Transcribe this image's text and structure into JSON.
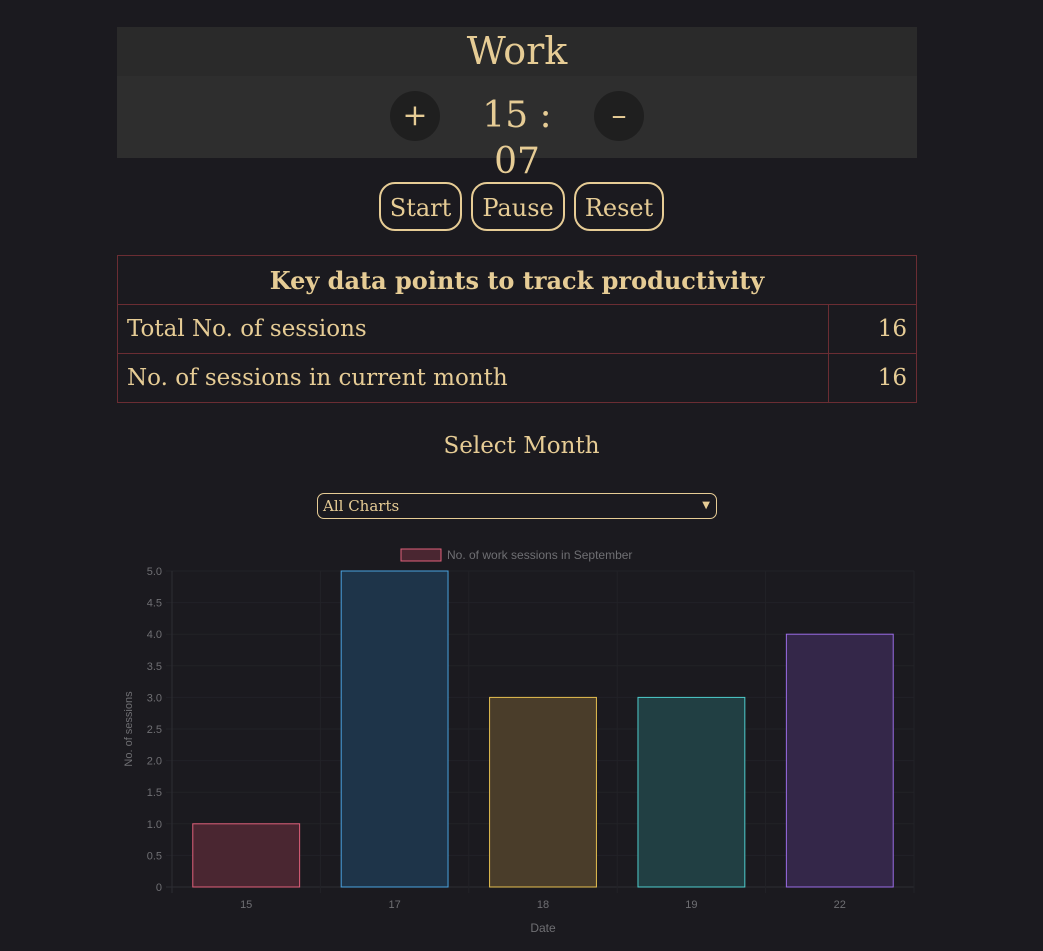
{
  "timer": {
    "mode": "Work",
    "increase_label": "+",
    "time": "15 : 07",
    "decrease_label": "–"
  },
  "controls": {
    "start": "Start",
    "pause": "Pause",
    "reset": "Reset"
  },
  "stats": {
    "heading": "Key data points to track productivity",
    "rows": [
      {
        "label": "Total No. of sessions",
        "value": "16"
      },
      {
        "label": "No. of sessions in current month",
        "value": "16"
      }
    ]
  },
  "month_select": {
    "heading": "Select Month",
    "selected": "All Charts"
  },
  "chart_data": {
    "type": "bar",
    "title": "",
    "legend": "No. of work sessions in September",
    "legend_position": "top",
    "xlabel": "Date",
    "ylabel": "No. of sessions",
    "categories": [
      "15",
      "17",
      "18",
      "19",
      "22"
    ],
    "values": [
      1,
      5,
      3,
      3,
      4
    ],
    "ylim": [
      0,
      5
    ],
    "yticks": [
      "0",
      "0.5",
      "1.0",
      "1.5",
      "2.0",
      "2.5",
      "3.0",
      "3.5",
      "4.0",
      "4.5",
      "5.0"
    ],
    "grid": true,
    "bar_colors": [
      {
        "fill": "#4a2631",
        "stroke": "#e0607a"
      },
      {
        "fill": "#1e3449",
        "stroke": "#4aa3e0"
      },
      {
        "fill": "#4a3d2a",
        "stroke": "#e6c050"
      },
      {
        "fill": "#213f43",
        "stroke": "#4ecccc"
      },
      {
        "fill": "#342749",
        "stroke": "#9a6ce6"
      }
    ],
    "legend_colors": {
      "fill": "#4a2631",
      "stroke": "#e0607a"
    }
  }
}
